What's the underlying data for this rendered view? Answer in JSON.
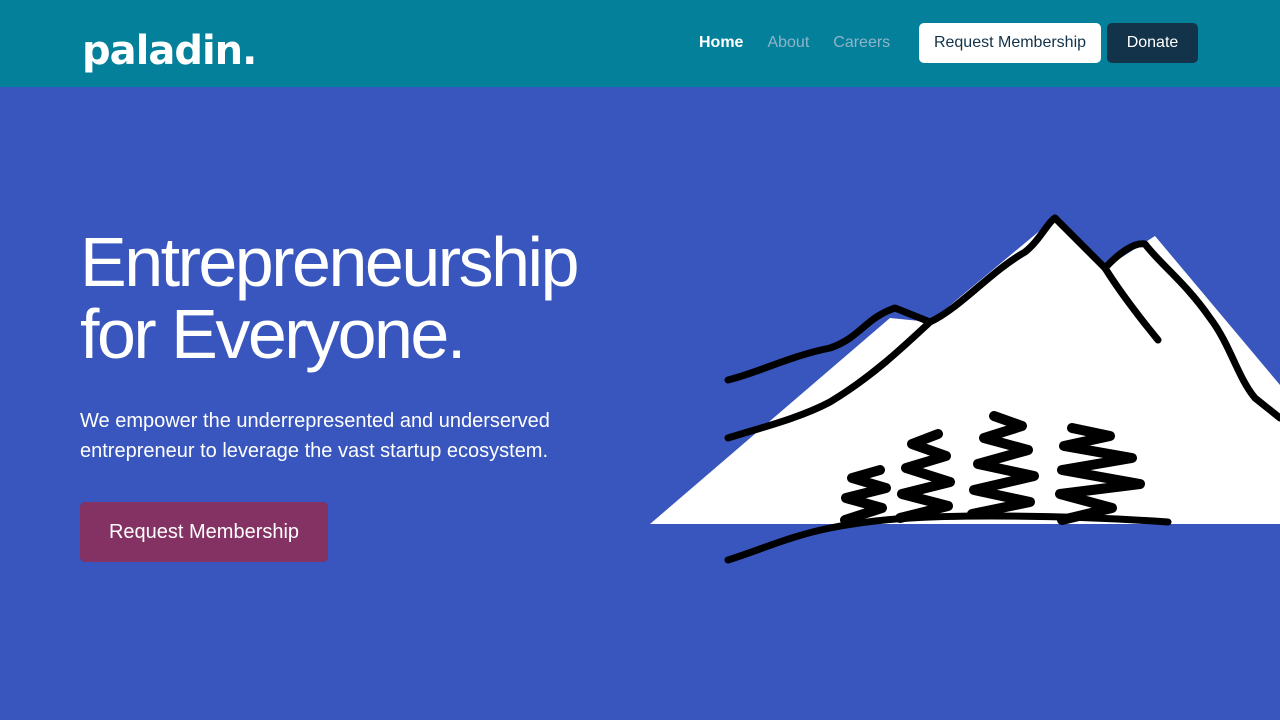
{
  "header": {
    "logo_text": "paladin.",
    "nav": [
      {
        "label": "Home",
        "active": true
      },
      {
        "label": "About",
        "active": false
      },
      {
        "label": "Careers",
        "active": false
      }
    ],
    "request_button_label": "Request Membership",
    "donate_button_label": "Donate"
  },
  "hero": {
    "title_line1": "Entrepreneurship",
    "title_line2": "for Everyone.",
    "subtitle_line1": "We empower the underrepresented and underserved",
    "subtitle_line2": "entrepreneur to leverage the vast startup ecosystem.",
    "cta_label": "Request Membership",
    "illustration_icon": "mountain-trees-icon"
  },
  "colors": {
    "nav_background": "#04809b",
    "hero_background": "#3856bd",
    "cta_background": "#843263",
    "donate_background": "#13334b"
  }
}
